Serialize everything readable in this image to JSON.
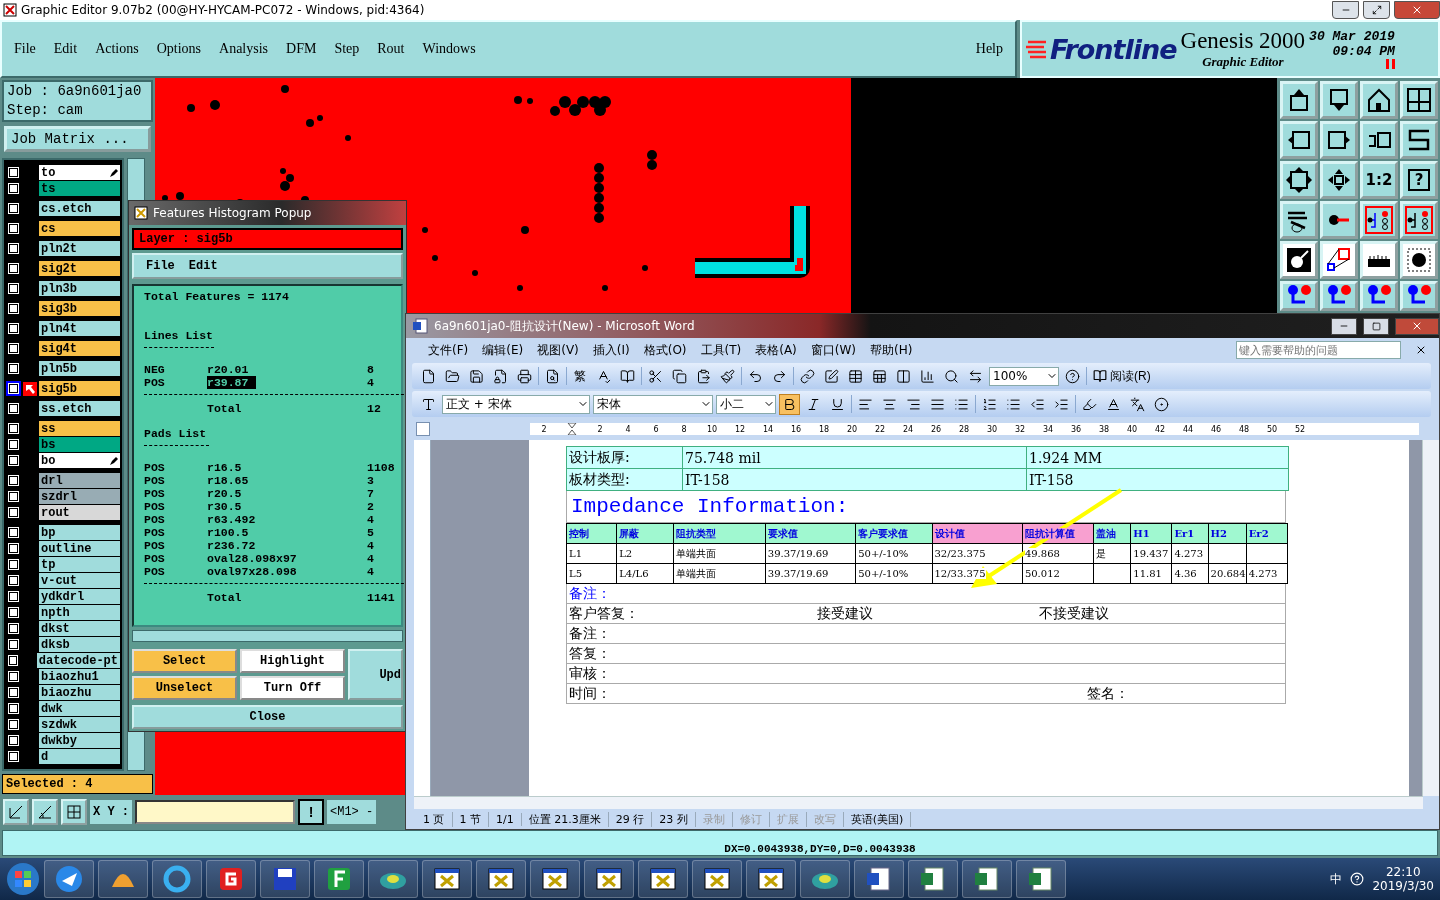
{
  "window": {
    "title": "Graphic Editor 9.07b2 (00@HY-HYCAM-PC072 - Windows, pid:4364)"
  },
  "menu": [
    "File",
    "Edit",
    "Actions",
    "Options",
    "Analysis",
    "DFM",
    "Step",
    "Rout",
    "Windows"
  ],
  "help": "Help",
  "logo": {
    "brand": "Frontline",
    "product": "Genesis 2000",
    "subtitle": "Graphic Editor",
    "date": "30 Mar 2019",
    "time": "09:04 PM"
  },
  "job": {
    "job": "Job : 6a9n601ja0",
    "step": "Step: cam",
    "matrix": "Job Matrix ..."
  },
  "layer_groups": [
    [
      {
        "name": "to",
        "color": "#ffffff",
        "selected": false,
        "flag": true
      },
      {
        "name": "ts",
        "color": "#00a884",
        "selected": false,
        "flag": false
      }
    ],
    [
      {
        "name": "cs.etch",
        "color": "#a0dcdc",
        "selected": false,
        "flag": false
      }
    ],
    [
      {
        "name": "cs",
        "color": "#f8c048",
        "selected": false,
        "flag": false
      }
    ],
    [
      {
        "name": "pln2t",
        "color": "#a0dcdc",
        "selected": false,
        "flag": false
      }
    ],
    [
      {
        "name": "sig2t",
        "color": "#f8c048",
        "selected": false,
        "flag": false
      }
    ],
    [
      {
        "name": "pln3b",
        "color": "#a0dcdc",
        "selected": false,
        "flag": false
      }
    ],
    [
      {
        "name": "sig3b",
        "color": "#f8c048",
        "selected": false,
        "flag": false
      }
    ],
    [
      {
        "name": "pln4t",
        "color": "#a0dcdc",
        "selected": false,
        "flag": false
      }
    ],
    [
      {
        "name": "sig4t",
        "color": "#f8c048",
        "selected": false,
        "flag": false
      }
    ],
    [
      {
        "name": "pln5b",
        "color": "#a0dcdc",
        "selected": false,
        "flag": false
      }
    ],
    [
      {
        "name": "sig5b",
        "color": "#f8c048",
        "selected": true,
        "flag": false
      }
    ],
    [
      {
        "name": "ss.etch",
        "color": "#a0dcdc",
        "selected": false,
        "flag": false
      }
    ],
    [
      {
        "name": "ss",
        "color": "#f8c048",
        "selected": false,
        "flag": false
      },
      {
        "name": "bs",
        "color": "#00a884",
        "selected": false,
        "flag": false
      },
      {
        "name": "bo",
        "color": "#ffffff",
        "selected": false,
        "flag": true
      }
    ],
    [
      {
        "name": "drl",
        "color": "#98acb4",
        "selected": false,
        "flag": false
      },
      {
        "name": "szdrl",
        "color": "#98acb4",
        "selected": false,
        "flag": false
      },
      {
        "name": "rout",
        "color": "#d8d8d8",
        "selected": false,
        "flag": false
      }
    ],
    [
      {
        "name": "bp",
        "color": "#a0dcdc",
        "selected": false,
        "flag": false
      },
      {
        "name": "outline",
        "color": "#a0dcdc",
        "selected": false,
        "flag": false
      },
      {
        "name": "tp",
        "color": "#a0dcdc",
        "selected": false,
        "flag": false
      },
      {
        "name": "v-cut",
        "color": "#a0dcdc",
        "selected": false,
        "flag": false
      },
      {
        "name": "ydkdrl",
        "color": "#a0dcdc",
        "selected": false,
        "flag": false
      },
      {
        "name": "npth",
        "color": "#a0dcdc",
        "selected": false,
        "flag": false
      },
      {
        "name": "dkst",
        "color": "#a0dcdc",
        "selected": false,
        "flag": false
      },
      {
        "name": "dksb",
        "color": "#a0dcdc",
        "selected": false,
        "flag": false
      },
      {
        "name": "datecode-pt",
        "color": "#a0dcdc",
        "selected": false,
        "flag": false
      },
      {
        "name": "biaozhu1",
        "color": "#a0dcdc",
        "selected": false,
        "flag": false
      },
      {
        "name": "biaozhu",
        "color": "#a0dcdc",
        "selected": false,
        "flag": false
      },
      {
        "name": "dwk",
        "color": "#a0dcdc",
        "selected": false,
        "flag": false
      },
      {
        "name": "szdwk",
        "color": "#a0dcdc",
        "selected": false,
        "flag": false
      },
      {
        "name": "dwkby",
        "color": "#a0dcdc",
        "selected": false,
        "flag": false
      },
      {
        "name": "d",
        "color": "#a0dcdc",
        "selected": false,
        "flag": false
      }
    ]
  ],
  "selected_count": "Selected : 4",
  "tools": {
    "ratio": "1:2",
    "help": "?"
  },
  "bottom_bar": {
    "xy_label": "X Y :",
    "alert": "!",
    "mode": "<M1> -"
  },
  "status": "DX=0.0043938,DY=0,D=0.0043938",
  "popup": {
    "title": "Features Histogram Popup",
    "layer": "Layer :  sig5b",
    "menu": [
      "File",
      "Edit"
    ],
    "total": "Total Features = 1174",
    "lines_title": "Lines List",
    "pads_title": "Pads List",
    "lines_total_label": "Total",
    "pads_total_label": "Total",
    "lines": [
      {
        "polarity": "NEG",
        "symbol": "r20.01",
        "count": "8",
        "selected": false
      },
      {
        "polarity": "POS",
        "symbol": "r39.87",
        "count": "4",
        "selected": true
      }
    ],
    "lines_total": "12",
    "pads": [
      {
        "polarity": "POS",
        "symbol": "r16.5",
        "count": "1108"
      },
      {
        "polarity": "POS",
        "symbol": "r18.65",
        "count": "3"
      },
      {
        "polarity": "POS",
        "symbol": "r20.5",
        "count": "7"
      },
      {
        "polarity": "POS",
        "symbol": "r30.5",
        "count": "2"
      },
      {
        "polarity": "POS",
        "symbol": "r63.492",
        "count": "4"
      },
      {
        "polarity": "POS",
        "symbol": "r100.5",
        "count": "5"
      },
      {
        "polarity": "POS",
        "symbol": "r236.72",
        "count": "4"
      },
      {
        "polarity": "POS",
        "symbol": "oval28.098x97",
        "count": "4"
      },
      {
        "polarity": "POS",
        "symbol": "oval97x28.098",
        "count": "4"
      }
    ],
    "pads_total": "1141",
    "buttons": [
      {
        "label": "Select",
        "color": "#f8c048"
      },
      {
        "label": "Highlight",
        "color": "#ffffff"
      },
      {
        "label": "Unselect",
        "color": "#f8c048"
      },
      {
        "label": "Turn Off",
        "color": "#ffffff"
      }
    ],
    "update": "Upd",
    "close": "Close"
  },
  "word": {
    "title": "6a9n601ja0-阻抗设计(New) - Microsoft Word",
    "menu": [
      "文件(F)",
      "编辑(E)",
      "视图(V)",
      "插入(I)",
      "格式(O)",
      "工具(T)",
      "表格(A)",
      "窗口(W)",
      "帮助(H)"
    ],
    "help_placeholder": "键入需要帮助的问题",
    "trad": "繁",
    "zoom": "100%",
    "read": "阅读(R)",
    "style": "正文 + 宋体",
    "font": "宋体",
    "size": "小二",
    "format_buttons": [
      {
        "kind": "bold",
        "on": true
      },
      {
        "kind": "italic",
        "on": false
      },
      {
        "kind": "underline",
        "on": false
      }
    ],
    "ruler": [
      "2",
      "2",
      "4",
      "6",
      "8",
      "10",
      "12",
      "14",
      "16",
      "18",
      "20",
      "22",
      "24",
      "26",
      "28",
      "30",
      "32",
      "34",
      "36",
      "38",
      "40",
      "42",
      "44",
      "46",
      "48",
      "50",
      "52"
    ],
    "board_rows": [
      [
        "设计板厚:",
        "75.748 mil",
        "1.924 MM"
      ],
      [
        "板材类型:",
        "IT-158",
        "IT-158"
      ]
    ],
    "heading": "Impedance Information:",
    "imp_headers": [
      {
        "text": "控制",
        "color": "#a0f8d0"
      },
      {
        "text": "屏蔽",
        "color": "#a0f8d0"
      },
      {
        "text": "阻抗类型",
        "color": "#a0f8d0"
      },
      {
        "text": "要求值",
        "color": "#a0f8d0"
      },
      {
        "text": "客户要求值",
        "color": "#a0f8d0"
      },
      {
        "text": "设计值",
        "color": "#f8a0d0"
      },
      {
        "text": "阻抗计算值",
        "color": "#f8a0d0"
      },
      {
        "text": "盖油",
        "color": "#a0f8d0"
      },
      {
        "text": "H1",
        "color": "#a0f8d0"
      },
      {
        "text": "Er1",
        "color": "#a0f8d0"
      },
      {
        "text": "H2",
        "color": "#a0f8d0"
      },
      {
        "text": "Er2",
        "color": "#a0f8d0"
      }
    ],
    "imp_rows": [
      [
        "L1",
        "L2",
        "单端共面",
        "39.37/19.69",
        "50+/-10%",
        "32/23.375",
        "49.868",
        "是",
        "19.437",
        "4.273",
        "",
        ""
      ],
      [
        "L5",
        "L4/L6",
        "单端共面",
        "39.37/19.69",
        "50+/-10%",
        "12/33.375",
        "50.012",
        "",
        "11.81",
        "4.36",
        "20.684",
        "4.273"
      ]
    ],
    "remark": "备注：",
    "reply_row": [
      "客户答复：",
      "接受建议",
      "不接受建议"
    ],
    "notes": [
      "备注：",
      "答复：",
      "审核："
    ],
    "time_row": [
      "时间：",
      "签名："
    ],
    "status": [
      {
        "text": "1 页",
        "disabled": false
      },
      {
        "text": "1 节",
        "disabled": false
      },
      {
        "text": "1/1",
        "disabled": false
      },
      {
        "text": "位置 21.3厘米",
        "disabled": false
      },
      {
        "text": "29 行",
        "disabled": false
      },
      {
        "text": "23 列",
        "disabled": false
      },
      {
        "text": "录制",
        "disabled": true
      },
      {
        "text": "修订",
        "disabled": true
      },
      {
        "text": "扩展",
        "disabled": true
      },
      {
        "text": "改写",
        "disabled": true
      },
      {
        "text": "英语(美国)",
        "disabled": false
      }
    ]
  },
  "taskbar": {
    "ime": "中",
    "time": "22:10",
    "date": "2019/3/30"
  }
}
